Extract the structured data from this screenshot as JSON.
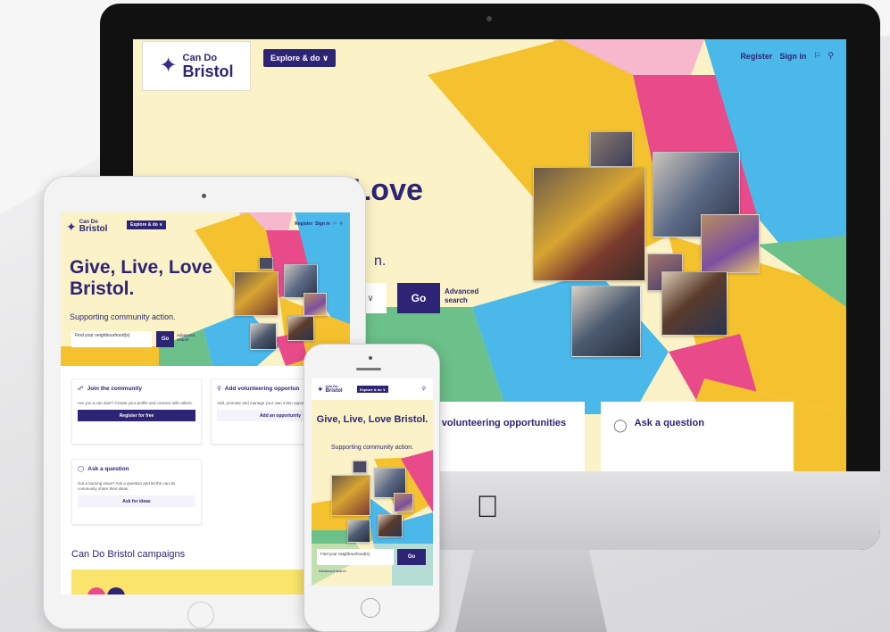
{
  "site": {
    "logo_line1": "Can Do",
    "logo_line2": "Bristol",
    "explore_label": "Explore & do ∨",
    "register_label": "Register",
    "signin_label": "Sign in"
  },
  "desktop": {
    "hero_title_fragment": "Give, Live, Love",
    "hero_sub_fragment": "n.",
    "go_label": "Go",
    "advanced_search": "Advanced search",
    "select_chevron": "∨",
    "cards": [
      {
        "icon": "",
        "title": "d volunteering opportunities"
      },
      {
        "icon": "lightbulb-icon",
        "title": "Ask a question"
      }
    ]
  },
  "tablet": {
    "hero_title": "Give, Live, Love Bristol.",
    "hero_sub": "Supporting community action.",
    "select_text": "Find your neighbourhood(s)",
    "go_label": "Go",
    "advanced_search": "Advanced search",
    "cards": [
      {
        "title": "Join the community",
        "text": "Are you a can doer? Create your profile and connect with others.",
        "button": "Register for free"
      },
      {
        "title": "Add volunteering opportun",
        "text": "Add, promote and manage your own volun opportunities.",
        "button": "Add an opportunity"
      },
      {
        "title": "Ask a question",
        "text": "Got a burning issue? Ask a question and let the can do community share their ideas.",
        "button": "Ask for ideas"
      }
    ],
    "campaigns_heading": "Can Do Bristol campaigns"
  },
  "phone": {
    "hero_title": "Give, Live, Love Bristol.",
    "hero_sub": "Supporting community action.",
    "select_text": "Find your neighbourhood(s)",
    "go_label": "Go",
    "advanced_search": "Advanced search"
  },
  "colors": {
    "brand_purple": "#2e2475",
    "yellow": "#f5c22f",
    "pink": "#e94b8a",
    "blue": "#4bb8ea",
    "green": "#6cc08a",
    "cream": "#fbf3c7"
  }
}
